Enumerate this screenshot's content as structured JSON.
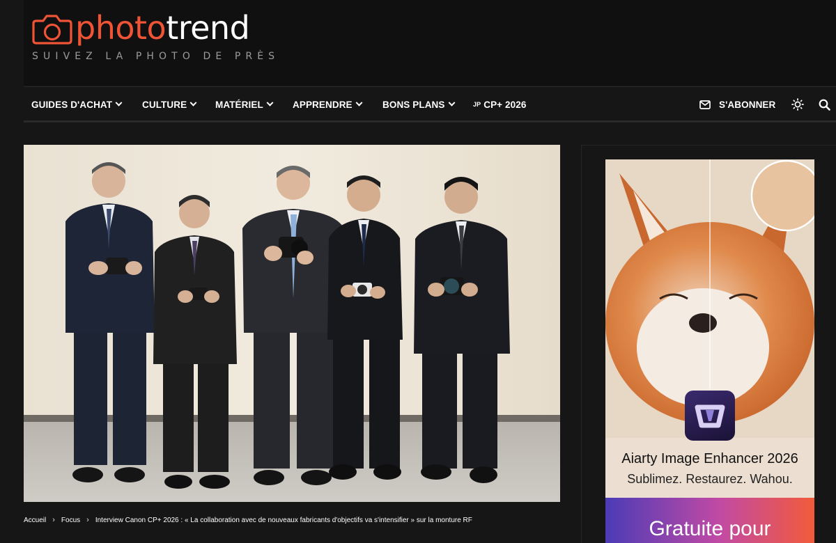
{
  "brand": {
    "name_part1": "photo",
    "name_part2": "trend",
    "tagline": "SUIVEZ LA PHOTO DE PRÈS",
    "accent_color": "#ef5436"
  },
  "nav": {
    "items": [
      {
        "label": "GUIDES D'ACHAT",
        "has_dropdown": true
      },
      {
        "label": "CULTURE",
        "has_dropdown": true
      },
      {
        "label": "MATÉRIEL",
        "has_dropdown": true
      },
      {
        "label": "APPRENDRE",
        "has_dropdown": true
      },
      {
        "label": "BONS PLANS",
        "has_dropdown": true
      },
      {
        "prefix": "JP",
        "label": "CP+ 2026",
        "has_dropdown": false
      }
    ],
    "subscribe_label": "S'ABONNER",
    "icons": [
      "mail-icon",
      "sun-icon",
      "search-icon"
    ]
  },
  "breadcrumb": {
    "items": [
      "Accueil",
      "Focus",
      "Interview Canon CP+ 2026 : « La collaboration avec de nouveaux fabricants d'objectifs va s'intensifier » sur la monture RF"
    ]
  },
  "ad": {
    "product_name": "Aiarty Image Enhancer 2026",
    "tagline": "Sublimez. Restaurez. Wahou.",
    "cta": "Gratuite pour"
  }
}
